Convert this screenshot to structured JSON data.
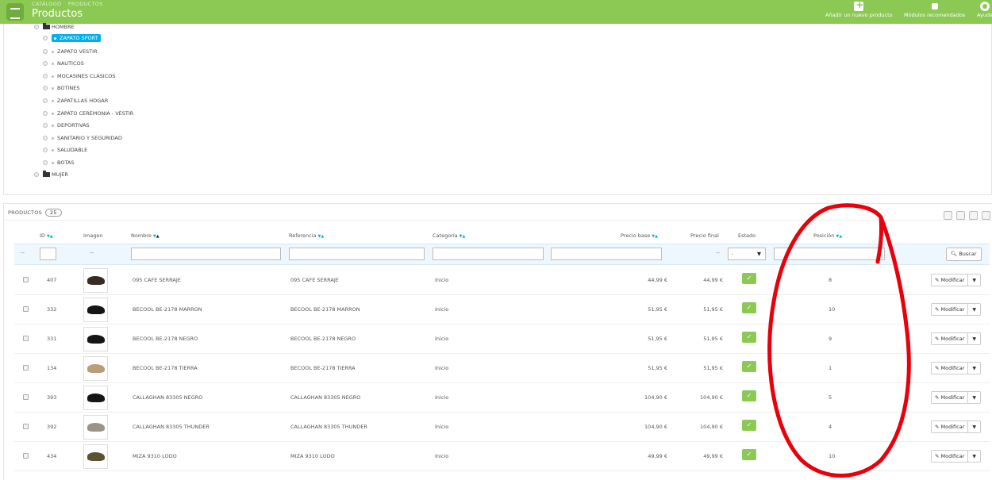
{
  "header": {
    "breadcrumb": [
      "CATÁLOGO",
      "PRODUCTOS"
    ],
    "title": "Productos",
    "actions": [
      {
        "label": "Añadir un nuevo producto",
        "icon": "add-icon"
      },
      {
        "label": "Módulos recomendados",
        "icon": "puzzle-icon"
      },
      {
        "label": "Ayuda",
        "icon": "help-icon"
      }
    ]
  },
  "tree": {
    "root_hombre": "HOMBRE",
    "children": [
      "ZAPATO SPORT",
      "ZAPATO VESTIR",
      "NAUTICOS",
      "MOCASINES CLASICOS",
      "BOTINES",
      "ZAPATILLAS HOGAR",
      "ZAPATO CEREMONIA - VESTIR",
      "DEPORTIVAS",
      "SANITARIO Y SEGURIDAD",
      "SALUDABLE",
      "BOTAS"
    ],
    "selected": "ZAPATO SPORT",
    "root_mujer": "MUJER"
  },
  "products": {
    "heading": "PRODUCTOS",
    "count": "25",
    "columns": {
      "id": "ID",
      "image": "Imagen",
      "name": "Nombre",
      "reference": "Referencia",
      "category": "Categoría",
      "base_price": "Precio base",
      "final_price": "Precio final",
      "status": "Estado",
      "position": "Posición"
    },
    "filter": {
      "dash": "--",
      "status_value": "-",
      "search_label": "Buscar"
    },
    "edit_label": "Modificar",
    "rows": [
      {
        "id": "407",
        "name": "095 CAFE SERRAJE",
        "ref": "095 CAFE SERRAJE",
        "category": "Inicio",
        "base": "44,99 €",
        "final": "44,99 €",
        "position": "8",
        "shoe": "brown"
      },
      {
        "id": "332",
        "name": "BECOOL BE-2178 MARRON",
        "ref": "BECOOL BE-2178 MARRON",
        "category": "Inicio",
        "base": "51,95 €",
        "final": "51,95 €",
        "position": "10",
        "shoe": "black"
      },
      {
        "id": "331",
        "name": "BECOOL BE-2178 NEGRO",
        "ref": "BECOOL BE-2178 NEGRO",
        "category": "Inicio",
        "base": "51,95 €",
        "final": "51,95 €",
        "position": "9",
        "shoe": "black"
      },
      {
        "id": "134",
        "name": "BECOOL BE-2178 TIERRA",
        "ref": "BECOOL BE-2178 TIERRA",
        "category": "Inicio",
        "base": "51,95 €",
        "final": "51,95 €",
        "position": "1",
        "shoe": "tan"
      },
      {
        "id": "393",
        "name": "CALLAGHAN 83305 NEGRO",
        "ref": "CALLAGHAN 83305 NEGRO",
        "category": "Inicio",
        "base": "104,90 €",
        "final": "104,90 €",
        "position": "5",
        "shoe": "black"
      },
      {
        "id": "392",
        "name": "CALLAGHAN 83305 THUNDER",
        "ref": "CALLAGHAN 83305 THUNDER",
        "category": "Inicio",
        "base": "104,90 €",
        "final": "104,90 €",
        "position": "4",
        "shoe": "grey"
      },
      {
        "id": "434",
        "name": "MIZA 9310 LODO",
        "ref": "MIZA 9310 LODO",
        "category": "Inicio",
        "base": "49,99 €",
        "final": "49,99 €",
        "position": "10",
        "shoe": "olive"
      }
    ]
  },
  "colors": {
    "header_green": "#8bc954",
    "selected_blue": "#00aff0",
    "annotation_red": "#e8000a"
  }
}
